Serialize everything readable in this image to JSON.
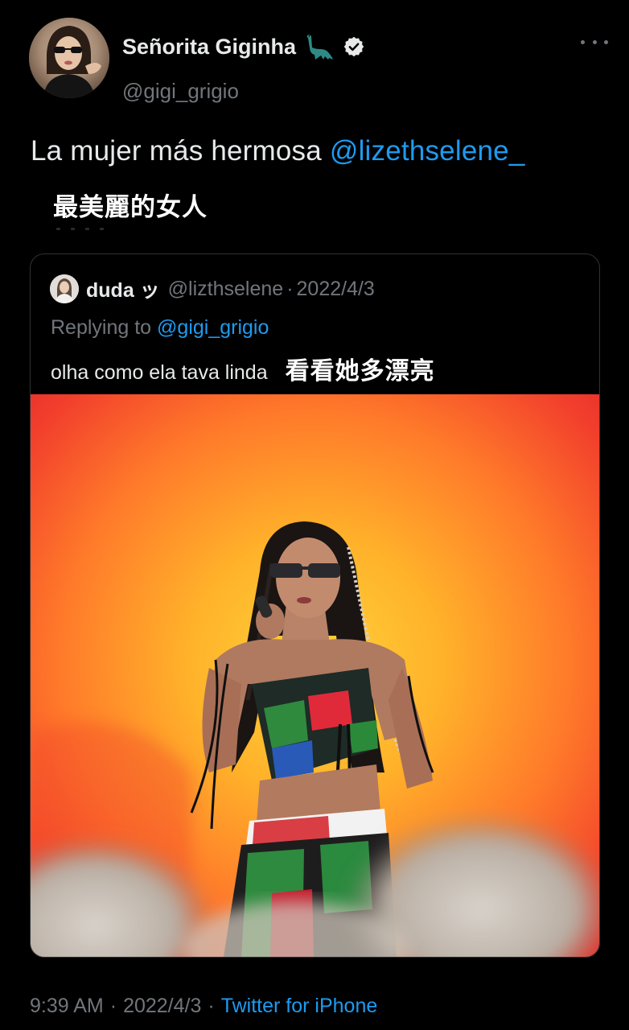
{
  "colors": {
    "background": "#000000",
    "text_primary": "#e7e9ea",
    "text_secondary": "#71767b",
    "link": "#1d9bf0",
    "border": "#2f3336"
  },
  "tweet": {
    "author": {
      "display_name": "Señorita Giginha",
      "name_emoji_icon": "dinosaur-icon",
      "verified_icon": "verified-badge-icon",
      "handle": "@gigi_grigio"
    },
    "more_icon": "more-options-icon",
    "text_before_mention": "La mujer más hermosa ",
    "mention": "@lizethselene_",
    "translation": "最美麗的女人"
  },
  "quoted_tweet": {
    "author_name": "duda ッ",
    "author_handle": "@lizthselene",
    "separator": "·",
    "date": "2022/4/3",
    "replying_prefix": "Replying to ",
    "replying_to": "@gigi_grigio",
    "text": "olha como ela tava linda",
    "translation": "看看她多漂亮",
    "media_description_icon": "concert-photo-image"
  },
  "footer": {
    "time": "9:39 AM",
    "separator_1": "·",
    "date": "2022/4/3",
    "separator_2": "·",
    "source": "Twitter for iPhone"
  }
}
